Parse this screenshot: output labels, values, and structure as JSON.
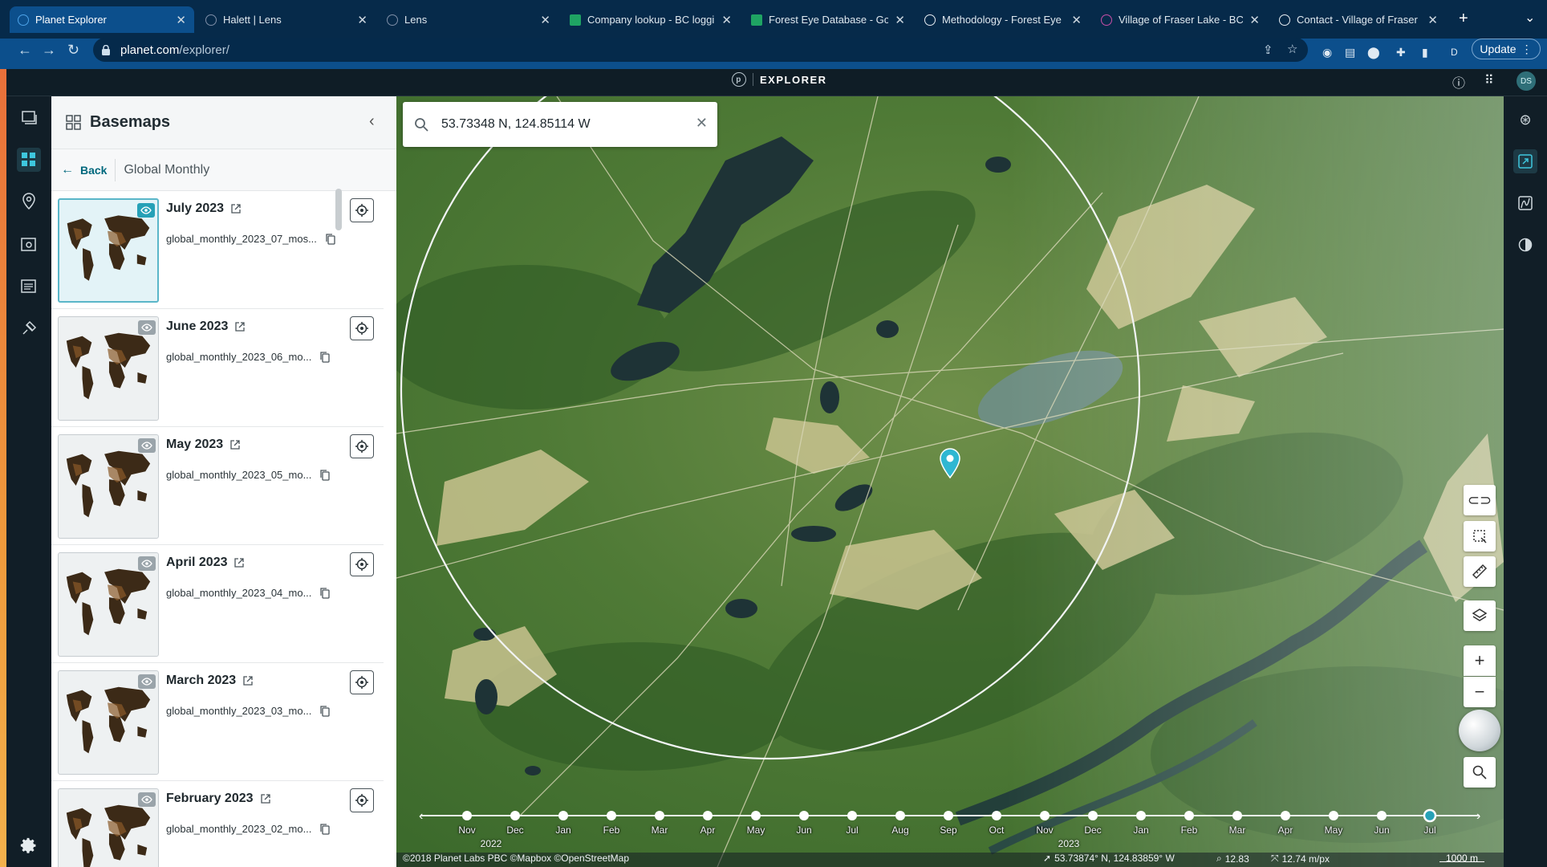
{
  "browser": {
    "tabs": [
      {
        "title": "Planet Explorer",
        "icon": "planet-icon",
        "active": true
      },
      {
        "title": "Halett | Lens",
        "icon": "lens-icon",
        "active": false
      },
      {
        "title": "Lens",
        "icon": "lens-icon",
        "active": false
      },
      {
        "title": "Company lookup - BC loggi",
        "icon": "sheets-icon",
        "active": false
      },
      {
        "title": "Forest Eye Database - Goog",
        "icon": "sheets-icon",
        "active": false
      },
      {
        "title": "Methodology - Forest Eye",
        "icon": "globe-icon",
        "active": false
      },
      {
        "title": "Village of Fraser Lake - BC /",
        "icon": "village-icon",
        "active": false
      },
      {
        "title": "Contact - Village of Fraser L",
        "icon": "globe-icon",
        "active": false
      }
    ],
    "url_host": "planet.com",
    "url_path": "/explorer/",
    "update_label": "Update",
    "profile_initial": "D"
  },
  "app": {
    "name": "EXPLORER",
    "logo_letter": "p",
    "avatar": "DS"
  },
  "panel": {
    "title": "Basemaps",
    "back_label": "Back",
    "collection": "Global Monthly",
    "items": [
      {
        "title": "July 2023",
        "id": "global_monthly_2023_07_mos...",
        "selected": true
      },
      {
        "title": "June 2023",
        "id": "global_monthly_2023_06_mo...",
        "selected": false
      },
      {
        "title": "May 2023",
        "id": "global_monthly_2023_05_mo...",
        "selected": false
      },
      {
        "title": "April 2023",
        "id": "global_monthly_2023_04_mo...",
        "selected": false
      },
      {
        "title": "March 2023",
        "id": "global_monthly_2023_03_mo...",
        "selected": false
      },
      {
        "title": "February 2023",
        "id": "global_monthly_2023_02_mo...",
        "selected": false
      }
    ]
  },
  "map": {
    "search_value": "53.73348 N, 124.85114 W",
    "timeline": {
      "months": [
        "Nov",
        "Dec",
        "Jan",
        "Feb",
        "Mar",
        "Apr",
        "May",
        "Jun",
        "Jul",
        "Aug",
        "Sep",
        "Oct",
        "Nov",
        "Dec",
        "Jan",
        "Feb",
        "Mar",
        "Apr",
        "May",
        "Jun",
        "Jul"
      ],
      "selected_index": 20,
      "year_labels": [
        {
          "label": "2022",
          "at_index": 0.5
        },
        {
          "label": "2023",
          "at_index": 12.5
        }
      ]
    },
    "attribution": "©2018 Planet Labs PBC ©Mapbox ©OpenStreetMap",
    "cursor_coords": "53.73874° N, 124.83859° W",
    "zoom_level": "12.83",
    "resolution": "12.74 m/px",
    "scale_label": "1000 m"
  },
  "colors": {
    "accent": "#26a1b7",
    "browser_bg": "#062a4a",
    "app_bar": "#0f1d26"
  }
}
